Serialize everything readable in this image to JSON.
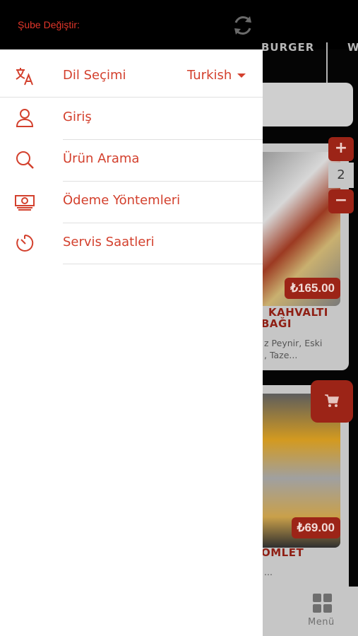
{
  "header": {
    "branch_label": "Şube Değiştir:"
  },
  "categories": [
    "BURGER",
    "W"
  ],
  "products": [
    {
      "price": "₺165.00",
      "title_line1": "KAHVALTI",
      "title_line2": "BAĞI",
      "desc_line1": "z Peynir, Eski",
      "desc_line2": ", Taze..."
    },
    {
      "price": "₺69.00",
      "title_line1": "OMLET",
      "desc_line1": "..."
    }
  ],
  "quantity": {
    "plus": "+",
    "value": "2",
    "minus": "−"
  },
  "bottom_nav": {
    "menu_label": "Menü"
  },
  "drawer": {
    "items": [
      {
        "label": "Dil Seçimi",
        "icon": "translate-icon",
        "value": "Turkish"
      },
      {
        "label": "Giriş",
        "icon": "user-icon"
      },
      {
        "label": "Ürün Arama",
        "icon": "search-icon"
      },
      {
        "label": "Ödeme Yöntemleri",
        "icon": "money-icon"
      },
      {
        "label": "Servis Saatleri",
        "icon": "timer-icon"
      }
    ]
  },
  "colors": {
    "accent": "#d3402d",
    "dark_red": "#9c2417"
  }
}
